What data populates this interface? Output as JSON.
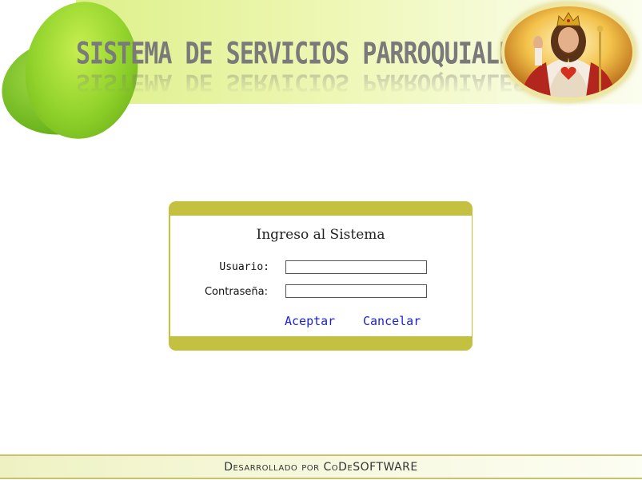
{
  "header": {
    "title": "SISTEMA DE SERVICIOS PARROQUIALES",
    "portrait_icon": "sacred-heart-portrait"
  },
  "login": {
    "title": "Ingreso al Sistema",
    "user_label": "Usuario:",
    "password_label": "Contraseña:",
    "user_value": "",
    "password_value": "",
    "accept_label": "Aceptar",
    "cancel_label": "Cancelar"
  },
  "footer": {
    "text": "Desarrollado por CoDeSOFTWARE"
  },
  "colors": {
    "accent": "#c4c040",
    "link": "#1a22d8",
    "leaf": "#8fd12a"
  }
}
